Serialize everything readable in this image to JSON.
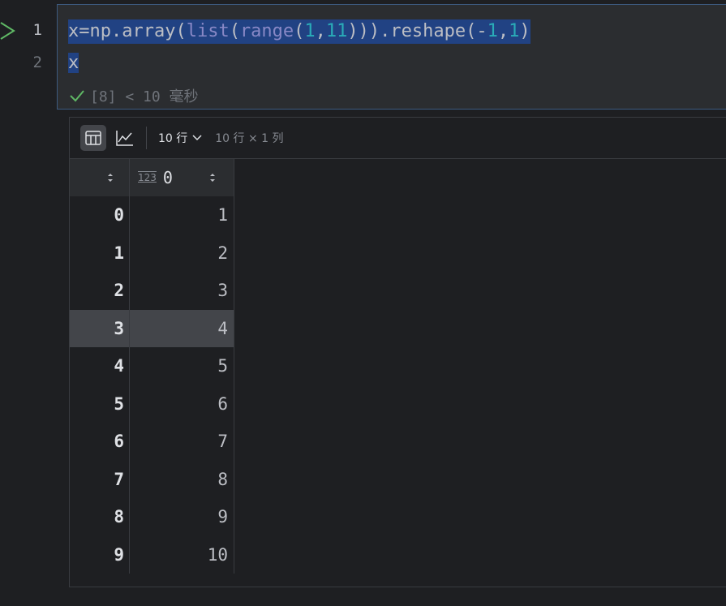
{
  "editor": {
    "line_numbers": [
      "1",
      "2"
    ],
    "code": {
      "line1": [
        {
          "t": "x=np.array(",
          "c": ""
        },
        {
          "t": "list",
          "c": "tok-builtin"
        },
        {
          "t": "(",
          "c": ""
        },
        {
          "t": "range",
          "c": "tok-builtin"
        },
        {
          "t": "(",
          "c": ""
        },
        {
          "t": "1",
          "c": "tok-num"
        },
        {
          "t": ",",
          "c": ""
        },
        {
          "t": "11",
          "c": "tok-num"
        },
        {
          "t": "))).reshape(-",
          "c": ""
        },
        {
          "t": "1",
          "c": "tok-num"
        },
        {
          "t": ",",
          "c": ""
        },
        {
          "t": "1",
          "c": "tok-num"
        },
        {
          "t": ")",
          "c": ""
        }
      ],
      "line2": "x"
    },
    "status": "[8] < 10 毫秒"
  },
  "output": {
    "rows_select_label": "10 行",
    "dims_label": "10 行 × 1 列",
    "column_type_label": "123",
    "column_header": "0",
    "highlighted_row": 3,
    "rows": [
      {
        "index": "0",
        "value": "1"
      },
      {
        "index": "1",
        "value": "2"
      },
      {
        "index": "2",
        "value": "3"
      },
      {
        "index": "3",
        "value": "4"
      },
      {
        "index": "4",
        "value": "5"
      },
      {
        "index": "5",
        "value": "6"
      },
      {
        "index": "6",
        "value": "7"
      },
      {
        "index": "7",
        "value": "8"
      },
      {
        "index": "8",
        "value": "9"
      },
      {
        "index": "9",
        "value": "10"
      }
    ]
  },
  "colors": {
    "selection": "#214283",
    "cell_border": "#3d5a80",
    "run_green": "#5fb865",
    "number": "#2aacb8"
  }
}
